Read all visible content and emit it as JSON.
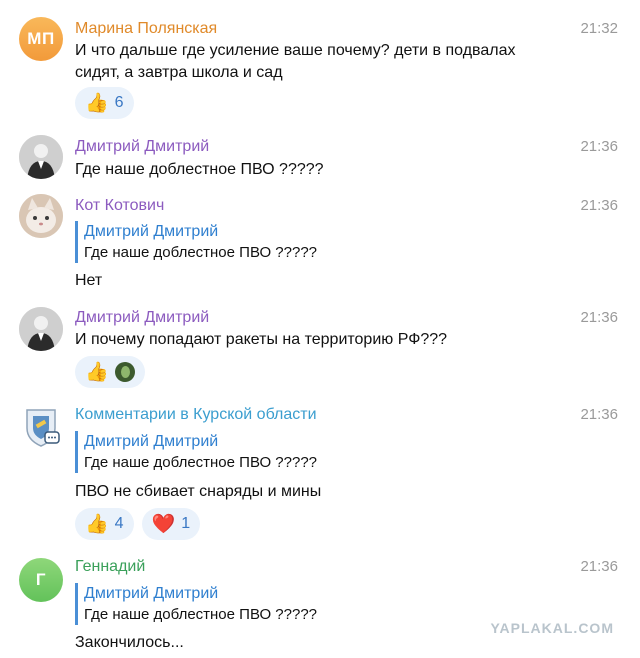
{
  "messages": [
    {
      "author": "Марина Полянская",
      "initials": "МП",
      "name_color": "#e08a2a",
      "time": "21:32",
      "lines": [
        "И что дальше где усиление ваше почему? дети в подвалах",
        "сидят, а завтра школа и сад"
      ],
      "reactions": [
        {
          "emoji": "👍",
          "count": "6"
        }
      ]
    },
    {
      "author": "Дмитрий Дмитрий",
      "name_color": "#8c5bbf",
      "time": "21:36",
      "text": "Где наше доблестное ПВО ?????"
    },
    {
      "author": "Кот Котович",
      "name_color": "#8c5bbf",
      "time": "21:36",
      "quote": {
        "author": "Дмитрий Дмитрий",
        "text": "Где наше доблестное ПВО ?????"
      },
      "text": "Нет"
    },
    {
      "author": "Дмитрий Дмитрий",
      "name_color": "#8c5bbf",
      "time": "21:36",
      "text": "И почему попадают ракеты на территорию РФ???",
      "reactions": [
        {
          "emoji": "👍"
        }
      ]
    },
    {
      "author": "Комментарии в Курской области",
      "name_color": "#3b9ecf",
      "time": "21:36",
      "quote": {
        "author": "Дмитрий Дмитрий",
        "text": "Где наше доблестное ПВО ?????"
      },
      "text": "ПВО не сбивает снаряды и мины",
      "reactions": [
        {
          "emoji": "👍",
          "count": "4"
        },
        {
          "emoji": "❤️",
          "count": "1"
        }
      ]
    },
    {
      "author": "Геннадий",
      "initials": "Г",
      "name_color": "#3aa05a",
      "time": "21:36",
      "quote": {
        "author": "Дмитрий Дмитрий",
        "text": "Где наше доблестное ПВО ?????"
      },
      "text": "Закончилось..."
    }
  ],
  "watermark": "YAPLAKAL.COM"
}
